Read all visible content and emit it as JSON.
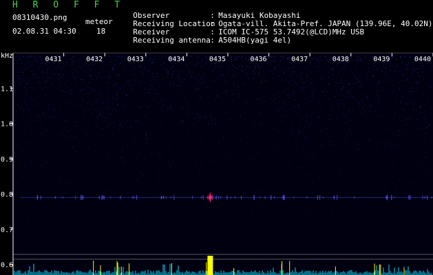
{
  "header": {
    "brand": "H R O F F T",
    "filename": "08310430.png",
    "datetime": "02.08.31 04:30",
    "meteor_label": "meteor",
    "meteor_count": "18"
  },
  "station_info": [
    {
      "key": "Observer",
      "value": "Masayuki Kobayashi"
    },
    {
      "key": "Receiving Location",
      "value": "Ogata-vill. Akita-Pref. JAPAN (139.96E, 40.02N)"
    },
    {
      "key": "Receiver",
      "value": "ICOM IC-575 53.7492(@LCD)MHz USB"
    },
    {
      "key": "Receiving antenna",
      "value": "A504HB(yagi 4el)"
    }
  ],
  "chart_data": {
    "type": "heatmap",
    "y_unit": "kHz",
    "time_ticks": [
      "0431",
      "0432",
      "0433",
      "0434",
      "0435",
      "0436",
      "0437",
      "0438",
      "0439",
      "0440"
    ],
    "freq_ticks": [
      "1.1",
      "1.0",
      "0.9",
      "0.8",
      "0.7",
      "0.6"
    ],
    "freq_tick_values": [
      1.1,
      1.0,
      0.9,
      0.8,
      0.7,
      0.6
    ],
    "ylim": [
      0.57,
      1.2
    ],
    "xlim": [
      0,
      10
    ],
    "tone_freq": 0.79,
    "meteor_event": {
      "time_min": 4.57,
      "freq": 0.79
    },
    "colors": {
      "background": "#000010",
      "noise": "#2a2aa8",
      "tone": "#5a5aff",
      "meteor": "#ff2a6a",
      "burst": "#ffff00",
      "spectrum": "#00e0ff",
      "axis": "#ffffff",
      "brand": "#4bd24b"
    }
  }
}
